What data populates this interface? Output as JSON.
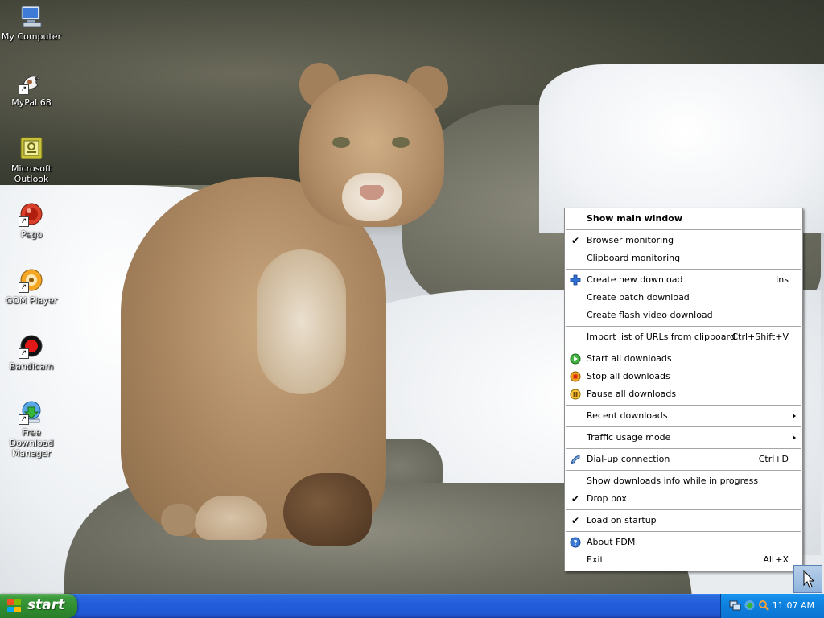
{
  "desktop_icons": [
    {
      "label": "My Computer",
      "icon": "my-computer-icon",
      "shortcut": false
    },
    {
      "label": "MyPal 68",
      "icon": "mypal-icon",
      "shortcut": true
    },
    {
      "label": "Microsoft Outlook",
      "icon": "outlook-icon",
      "shortcut": false
    },
    {
      "label": "Pego",
      "icon": "pego-icon",
      "shortcut": true
    },
    {
      "label": "GOM Player",
      "icon": "gom-player-icon",
      "shortcut": true
    },
    {
      "label": "Bandicam",
      "icon": "bandicam-icon",
      "shortcut": true
    },
    {
      "label": "Free Download Manager",
      "icon": "fdm-icon",
      "shortcut": true
    }
  ],
  "context_menu": {
    "show_main_window": "Show main window",
    "browser_monitoring": "Browser monitoring",
    "clipboard_monitoring": "Clipboard monitoring",
    "create_new_download": "Create new download",
    "create_new_download_shortcut": "Ins",
    "create_batch_download": "Create batch download",
    "create_flash_video_download": "Create flash video download",
    "import_list": "Import list of URLs from clipboard",
    "import_list_shortcut": "Ctrl+Shift+V",
    "start_all": "Start all downloads",
    "stop_all": "Stop all downloads",
    "pause_all": "Pause all downloads",
    "recent_downloads": "Recent downloads",
    "traffic_usage_mode": "Traffic usage mode",
    "dialup_connection": "Dial-up connection",
    "dialup_shortcut": "Ctrl+D",
    "show_downloads_info": "Show downloads info while in progress",
    "drop_box": "Drop box",
    "load_on_startup": "Load on startup",
    "about_fdm": "About FDM",
    "exit": "Exit",
    "exit_shortcut": "Alt+X",
    "checked": {
      "browser_monitoring": true,
      "clipboard_monitoring": false,
      "drop_box": true,
      "load_on_startup": true
    }
  },
  "taskbar": {
    "start_label": "start",
    "clock": "11:07 AM"
  },
  "colors": {
    "taskbar_blue": "#245edb",
    "start_green": "#3c9b3c",
    "tray_blue": "#0f82e0"
  }
}
